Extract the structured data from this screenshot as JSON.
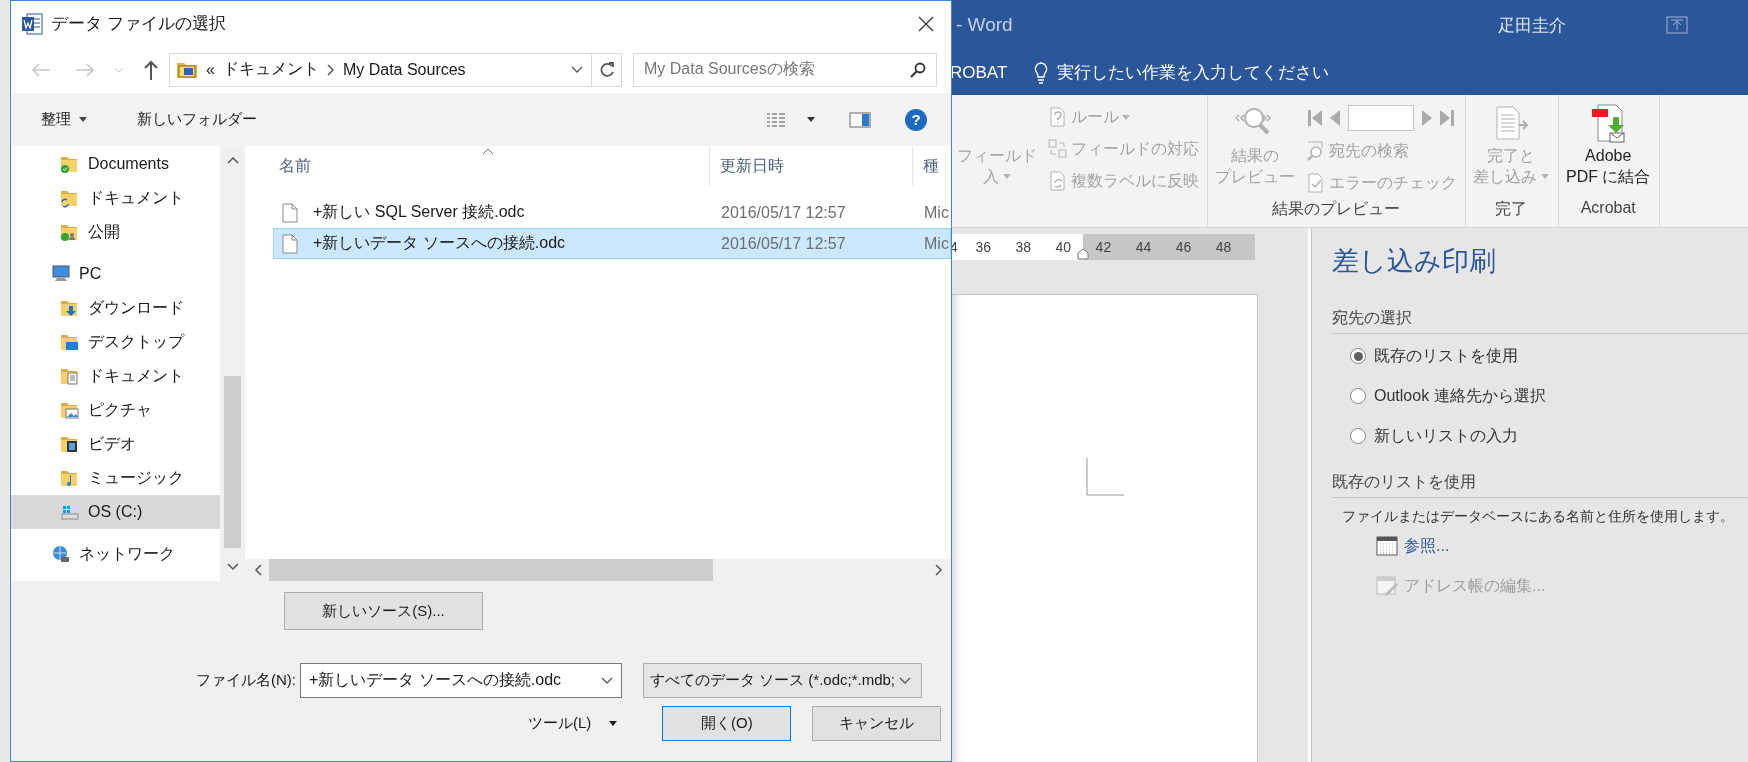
{
  "word_window": {
    "title": "- Word",
    "user": "疋田圭介",
    "tab_fragment": "ROBAT",
    "tell_me": "実行したい作業を入力してください",
    "ribbon_groups": [
      {
        "items": [
          {
            "kind": "large",
            "lines": [
              "フィールド",
              "入"
            ],
            "dropdown": true,
            "disabled": true
          },
          {
            "kind": "small_column",
            "buttons": [
              {
                "kind": "button",
                "label": "ルール",
                "dropdown": true,
                "disabled": true
              },
              {
                "kind": "button",
                "label": "フィールドの対応",
                "disabled": true
              },
              {
                "kind": "button",
                "label": "複数ラベルに反映",
                "disabled": true
              }
            ]
          }
        ]
      },
      {
        "label": "結果のプレビュー",
        "items": [
          {
            "kind": "large",
            "lines": [
              "結果の",
              "プレビュー"
            ],
            "disabled": true
          },
          {
            "kind": "small_column",
            "buttons": [
              {
                "kind": "record_nav"
              },
              {
                "kind": "button",
                "label": "宛先の検索",
                "disabled": true
              },
              {
                "kind": "button",
                "label": "エラーのチェック",
                "disabled": true
              }
            ]
          }
        ]
      },
      {
        "label": "完了",
        "items": [
          {
            "kind": "large",
            "lines": [
              "完了と",
              "差し込み"
            ],
            "dropdown": true,
            "disabled": true
          }
        ]
      },
      {
        "label": "Acrobat",
        "items": [
          {
            "kind": "large",
            "lines": [
              "Adobe",
              "PDF に結合"
            ],
            "disabled": false
          }
        ]
      }
    ],
    "ruler_labels": [
      "4",
      "36",
      "38",
      "40",
      "42",
      "44",
      "46",
      "48"
    ],
    "mail_merge_pane": {
      "title": "差し込み印刷",
      "recipient_heading": "宛先の選択",
      "options": [
        {
          "label": "既存のリストを使用",
          "selected": true
        },
        {
          "label": "Outlook 連絡先から選択",
          "selected": false
        },
        {
          "label": "新しいリストの入力",
          "selected": false
        }
      ],
      "list_heading": "既存のリストを使用",
      "description": "ファイルまたはデータベースにある名前と住所を使用します。",
      "links": [
        {
          "label": "参照...",
          "disabled": false
        },
        {
          "label": "アドレス帳の編集...",
          "disabled": true
        }
      ]
    }
  },
  "dialog": {
    "title": "データ ファイルの選択",
    "breadcrumb": {
      "overflow": "«",
      "parts": [
        "ドキュメント",
        "My Data Sources"
      ]
    },
    "search": {
      "placeholder": "My Data Sourcesの検索"
    },
    "toolbar": {
      "organize": "整理",
      "new_folder": "新しいフォルダー",
      "help": "?"
    },
    "nav_pane": {
      "sections": [
        {
          "items": [
            {
              "label": "Documents",
              "kind": "folder-ok",
              "selected": false
            },
            {
              "label": "ドキュメント",
              "kind": "folder-sync",
              "selected": false
            },
            {
              "label": "公開",
              "kind": "folder-shared",
              "selected": false
            }
          ]
        },
        {
          "label": "PC",
          "kind": "pc",
          "selected": false,
          "children": [
            {
              "label": "ダウンロード",
              "kind": "downloads",
              "selected": false
            },
            {
              "label": "デスクトップ",
              "kind": "desktop",
              "selected": false
            },
            {
              "label": "ドキュメント",
              "kind": "documents",
              "selected": false
            },
            {
              "label": "ピクチャ",
              "kind": "pictures",
              "selected": false
            },
            {
              "label": "ビデオ",
              "kind": "videos",
              "selected": false
            },
            {
              "label": "ミュージック",
              "kind": "music",
              "selected": false
            },
            {
              "label": "OS (C:)",
              "kind": "drive",
              "selected": true
            }
          ]
        },
        {
          "label": "ネットワーク",
          "kind": "network",
          "selected": false
        }
      ]
    },
    "columns": [
      "名前",
      "更新日時",
      "種"
    ],
    "files": [
      {
        "name": "+新しい SQL Server 接続.odc",
        "modified": "2016/05/17 12:57",
        "type": "Mic",
        "selected": false
      },
      {
        "name": "+新しいデータ ソースへの接続.odc",
        "modified": "2016/05/17 12:57",
        "type": "Mic",
        "selected": true
      }
    ],
    "new_source_button": "新しいソース(S)...",
    "file_name": {
      "label": "ファイル名(N):",
      "value": "+新しいデータ ソースへの接続.odc"
    },
    "file_type": "すべてのデータ ソース (*.odc;*.mdb;",
    "tools": "ツール(L)",
    "open_button": "開く(O)",
    "cancel_button": "キャンセル"
  }
}
